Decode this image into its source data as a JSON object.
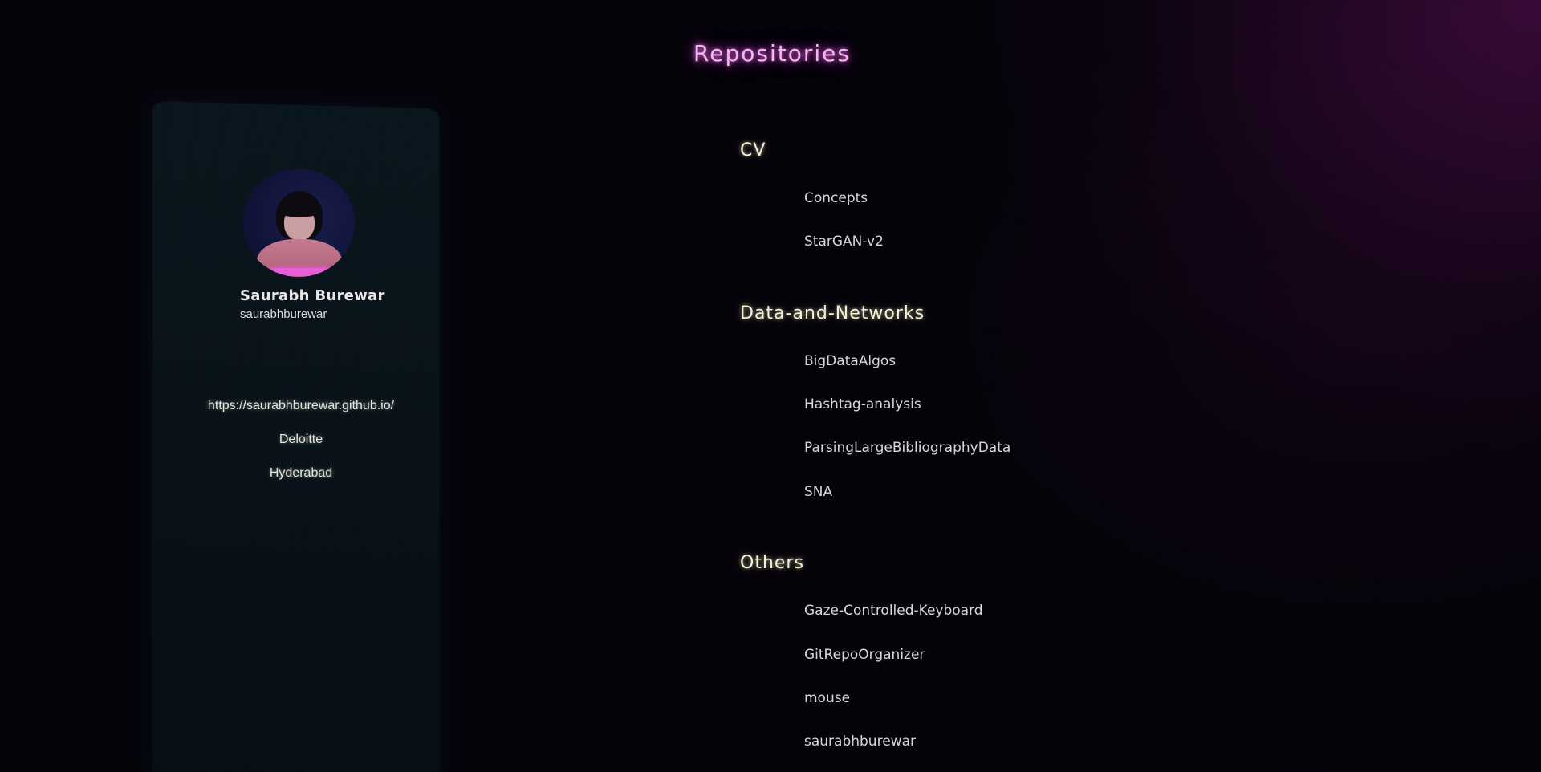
{
  "page": {
    "title": "Repositories"
  },
  "profile": {
    "name": "Saurabh Burewar",
    "username": "saurabhburewar",
    "website": "https://saurabhburewar.github.io/",
    "company": "Deloitte",
    "location": "Hyderabad",
    "avatar_icon": "avatar-illustration"
  },
  "repositories": {
    "sections": [
      {
        "title": "CV",
        "items": [
          "Concepts",
          "StarGAN-v2"
        ]
      },
      {
        "title": "Data-and-Networks",
        "items": [
          "BigDataAlgos",
          "Hashtag-analysis",
          "ParsingLargeBibliographyData",
          "SNA"
        ]
      },
      {
        "title": "Others",
        "items": [
          "Gaze-Controlled-Keyboard",
          "GitRepoOrganizer",
          "mouse",
          "saurabhburewar"
        ]
      }
    ]
  },
  "colors": {
    "background": "#05030a",
    "title_glow": "#f3b6f3",
    "section_title": "#f4f1d8",
    "item_text": "#d8d8d8",
    "card": "#0a161e"
  }
}
